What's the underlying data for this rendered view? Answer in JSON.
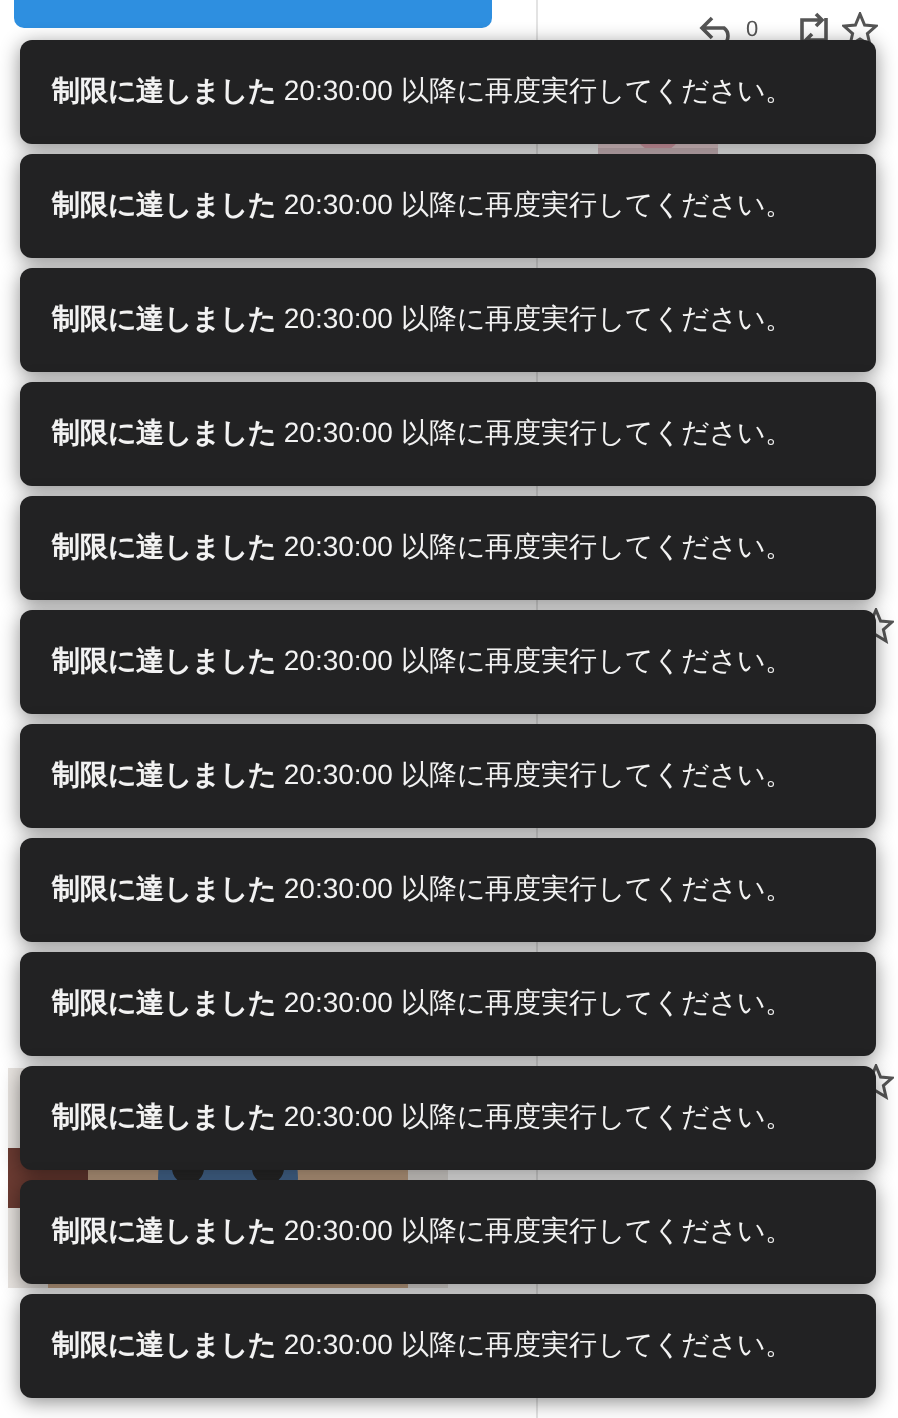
{
  "background": {
    "reply_count": "0"
  },
  "toasts": [
    {
      "text": "**制限に達しました** 20:30:00 以降に再度実行してください。"
    },
    {
      "text": "**制限に達しました** 20:30:00 以降に再度実行してください。"
    },
    {
      "text": "**制限に達しました** 20:30:00 以降に再度実行してください。"
    },
    {
      "text": "**制限に達しました** 20:30:00 以降に再度実行してください。"
    },
    {
      "text": "**制限に達しました** 20:30:00 以降に再度実行してください。"
    },
    {
      "text": "**制限に達しました** 20:30:00 以降に再度実行してください。"
    },
    {
      "text": "**制限に達しました** 20:30:00 以降に再度実行してください。"
    },
    {
      "text": "**制限に達しました** 20:30:00 以降に再度実行してください。"
    },
    {
      "text": "**制限に達しました** 20:30:00 以降に再度実行してください。"
    },
    {
      "text": "**制限に達しました** 20:30:00 以降に再度実行してください。"
    },
    {
      "text": "**制限に達しました** 20:30:00 以降に再度実行してください。"
    },
    {
      "text": "**制限に達しました** 20:30:00 以降に再度実行してください。"
    }
  ]
}
